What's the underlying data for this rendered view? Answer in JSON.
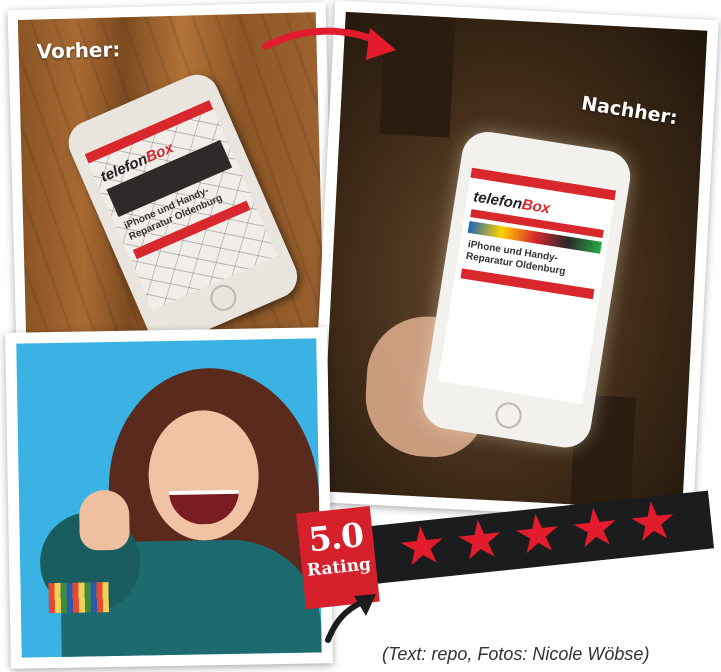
{
  "before_photo": {
    "label": "Vorher:"
  },
  "after_photo": {
    "label": "Nachher:"
  },
  "old_screen": {
    "brand_1": "telefon",
    "brand_2": "Box",
    "text": "iPhone und Handy-Reparatur Oldenburg"
  },
  "new_screen": {
    "brand_1": "telefon",
    "brand_2": "Box",
    "text": "iPhone und Handy-Reparatur Oldenburg"
  },
  "rating": {
    "value": "5.0",
    "word": "Rating",
    "stars": 5,
    "star_color": "#e21c2c",
    "banner_color": "#1b1c1e",
    "box_color": "#d6212d"
  },
  "credit": "(Text: repo, Fotos: Nicole Wöbse)",
  "colors": {
    "accent": "#d9272e",
    "woman_background": "#3ab2e3"
  }
}
